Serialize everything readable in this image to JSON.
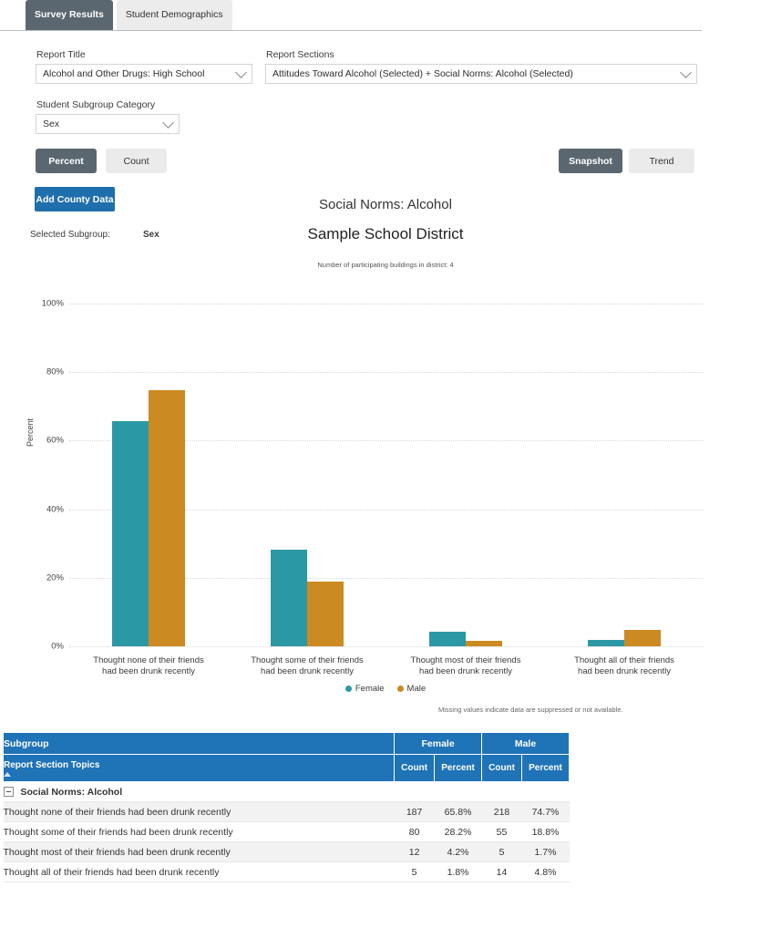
{
  "tabs": [
    {
      "label": "Survey Results",
      "active": true
    },
    {
      "label": "Student Demographics",
      "active": false
    }
  ],
  "filters": {
    "report_title_label": "Report Title",
    "report_title_value": "Alcohol and Other Drugs: High School",
    "report_sections_label": "Report Sections",
    "report_sections_value": "Attitudes Toward Alcohol (Selected) + Social Norms: Alcohol (Selected)",
    "subgroup_category_label": "Student Subgroup Category",
    "subgroup_category_value": "Sex"
  },
  "toolbar": {
    "percent_label": "Percent",
    "count_label": "Count",
    "snapshot_label": "Snapshot",
    "trend_label": "Trend",
    "add_county_data_label": "Add County Data",
    "selected_subgroup_label": "Selected Subgroup:",
    "selected_subgroup_value": "Sex"
  },
  "report": {
    "title": "Social Norms: Alcohol",
    "subtitle": "Sample School District",
    "note": "Number of participating buildings in district: 4",
    "footnote": "Missing values indicate data are suppressed or not available."
  },
  "colors": {
    "female": "#2b98a5",
    "male": "#cc8a22",
    "accent_blue": "#1f73b7",
    "dark_button": "#5b6770"
  },
  "chart_data": {
    "type": "bar",
    "title": "Social Norms: Alcohol",
    "subtitle": "Sample School District",
    "xlabel": "",
    "ylabel": "Percent",
    "ylim": [
      0,
      100
    ],
    "yticks": [
      "0%",
      "20%",
      "40%",
      "60%",
      "80%",
      "100%"
    ],
    "ytick_values": [
      0,
      20,
      40,
      60,
      80,
      100
    ],
    "grid": true,
    "legend_position": "bottom",
    "categories": [
      "Thought none of their friends had been drunk recently",
      "Thought some of their friends had been drunk recently",
      "Thought most of their friends had been drunk recently",
      "Thought all of their friends had been drunk recently"
    ],
    "categories_lines": [
      [
        "Thought none of their friends",
        "had been drunk recently"
      ],
      [
        "Thought some of their friends",
        "had been drunk recently"
      ],
      [
        "Thought most of their friends",
        "had been drunk recently"
      ],
      [
        "Thought all of their friends",
        "had been drunk recently"
      ]
    ],
    "series": [
      {
        "name": "Female",
        "color": "#2b98a5",
        "values": [
          65.8,
          28.2,
          4.2,
          1.8
        ]
      },
      {
        "name": "Male",
        "color": "#cc8a22",
        "values": [
          74.7,
          18.8,
          1.7,
          4.8
        ]
      }
    ]
  },
  "table": {
    "header": {
      "subgroup_label": "Subgroup",
      "topics_label": "Report Section Topics",
      "groups": [
        "Female",
        "Male"
      ],
      "measures": [
        "Count",
        "Percent",
        "Count",
        "Percent"
      ]
    },
    "group_row": "Social Norms: Alcohol",
    "rows": [
      {
        "topic": "Thought none of their friends had been drunk recently",
        "female_count": "187",
        "female_percent": "65.8%",
        "male_count": "218",
        "male_percent": "74.7%"
      },
      {
        "topic": "Thought some of their friends had been drunk recently",
        "female_count": "80",
        "female_percent": "28.2%",
        "male_count": "55",
        "male_percent": "18.8%"
      },
      {
        "topic": "Thought most of their friends had been drunk recently",
        "female_count": "12",
        "female_percent": "4.2%",
        "male_count": "5",
        "male_percent": "1.7%"
      },
      {
        "topic": "Thought all of their friends had been drunk recently",
        "female_count": "5",
        "female_percent": "1.8%",
        "male_count": "14",
        "male_percent": "4.8%"
      }
    ]
  }
}
